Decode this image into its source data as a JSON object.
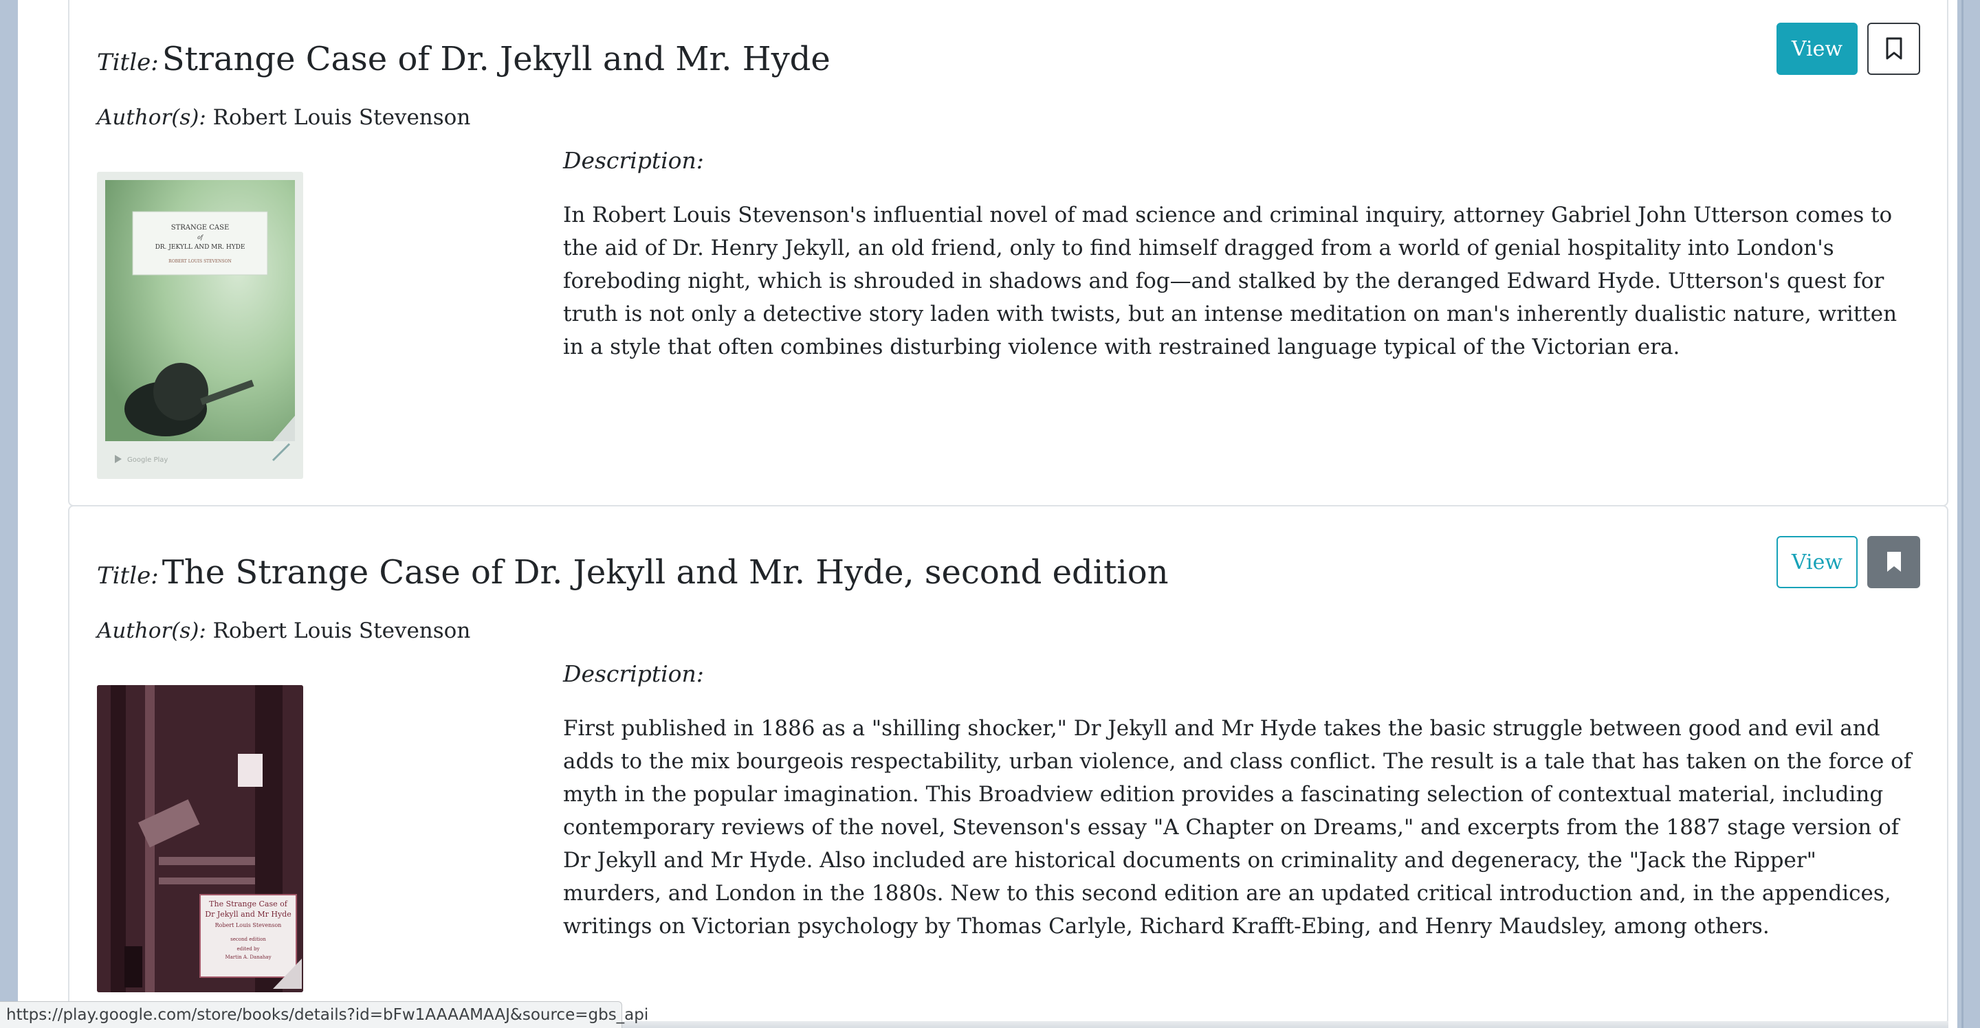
{
  "status_url": "https://play.google.com/store/books/details?id=bFw1AAAAMAAJ&source=gbs_api",
  "labels": {
    "title": "Title:",
    "authors": "Author(s):",
    "description": "Description:"
  },
  "colors": {
    "accent": "#17a2b8",
    "bookmark_dark": "#343a40",
    "bookmark_filled": "#6c757d"
  },
  "books": [
    {
      "title": "Strange Case of Dr. Jekyll and Mr. Hyde",
      "authors": "Robert Louis Stevenson",
      "view_label": "View",
      "bookmarked": false,
      "cover": {
        "line1": "STRANGE CASE",
        "line2": "of",
        "line3": "DR. JEKYLL AND MR. HYDE",
        "line4": "ROBERT LOUIS STEVENSON",
        "badge": "Google Play"
      },
      "description": "In Robert Louis Stevenson's influential novel of mad science and criminal inquiry, attorney Gabriel John Utterson comes to the aid of Dr. Henry Jekyll, an old friend, only to find himself dragged from a world of genial hospitality into London's foreboding night, which is shrouded in shadows and fog—and stalked by the deranged Edward Hyde. Utterson's quest for truth is not only a detective story laden with twists, but an intense meditation on man's inherently dualistic nature, written in a style that often combines disturbing violence with restrained language typical of the Victorian era."
    },
    {
      "title": "The Strange Case of Dr. Jekyll and Mr. Hyde, second edition",
      "authors": "Robert Louis Stevenson",
      "view_label": "View",
      "bookmarked": true,
      "cover": {
        "line1": "The Strange Case of",
        "line2": "Dr Jekyll and Mr Hyde",
        "line3": "Robert Louis Stevenson",
        "line4": "second edition",
        "line5": "edited by",
        "line6": "Martin A. Danahay"
      },
      "description": "First published in 1886 as a \"shilling shocker,\" Dr Jekyll and Mr Hyde takes the basic struggle between good and evil and adds to the mix bourgeois respectability, urban violence, and class conflict. The result is a tale that has taken on the force of myth in the popular imagination. This Broadview edition provides a fascinating selection of contextual material, including contemporary reviews of the novel, Stevenson's essay \"A Chapter on Dreams,\" and excerpts from the 1887 stage version of Dr Jekyll and Mr Hyde. Also included are historical documents on criminality and degeneracy, the \"Jack the Ripper\" murders, and London in the 1880s. New to this second edition are an updated critical introduction and, in the appendices, writings on Victorian psychology by Thomas Carlyle, Richard Krafft-Ebing, and Henry Maudsley, among others."
    }
  ]
}
